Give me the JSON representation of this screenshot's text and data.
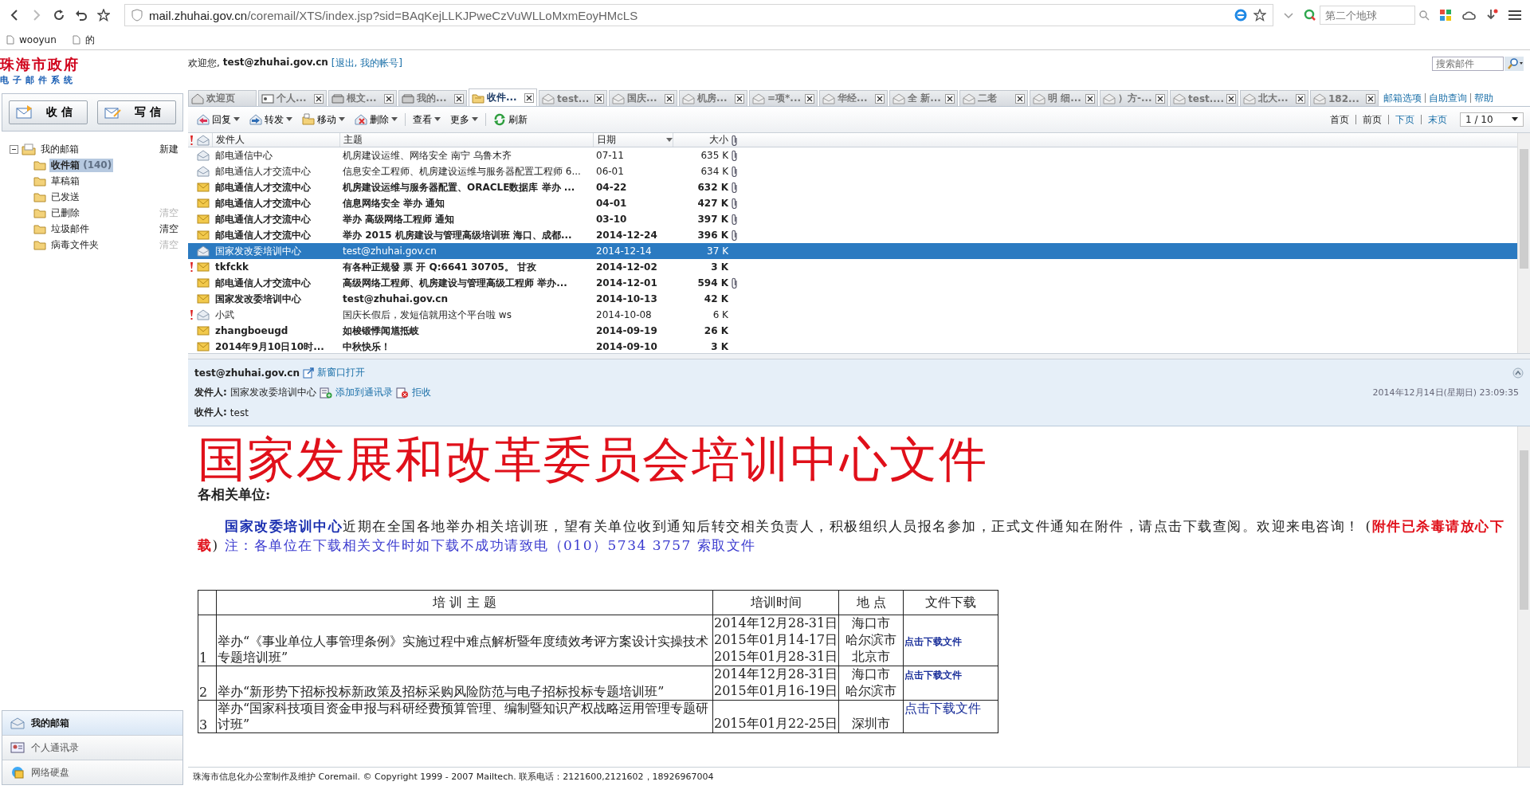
{
  "browser": {
    "url_host": "mail.zhuhai.gov.cn",
    "url_path": "/coremail/XTS/index.jsp?sid=BAqKejLLKJPweCzVuWLLoMxmEoyHMcLS",
    "search_placeholder": "第二个地球",
    "bookmarks": [
      "wooyun",
      "的"
    ]
  },
  "header": {
    "logo_title": "珠海市政府",
    "logo_subtitle": "电子邮件系统",
    "welcome": "欢迎您,",
    "user": "test@zhuhai.gov.cn",
    "account_links": "[退出, 我的帐号]",
    "search_placeholder": "搜索邮件"
  },
  "mail_buttons": [
    "收 信",
    "写 信"
  ],
  "folders": {
    "label": "我的邮箱",
    "action": "新建",
    "expanded": true,
    "children": [
      {
        "label": "收件箱",
        "count": "(140)",
        "selected": true
      },
      {
        "label": "草稿箱",
        "selected": false
      },
      {
        "label": "已发送",
        "selected": false
      },
      {
        "label": "已删除",
        "action": "清空",
        "disabled": true,
        "selected": false
      },
      {
        "label": "垃圾邮件",
        "action": "清空",
        "disabled": false,
        "selected": false
      },
      {
        "label": "病毒文件夹",
        "action": "清空",
        "disabled": true,
        "selected": false
      }
    ]
  },
  "nav": [
    {
      "label": "我的邮箱",
      "selected": true
    },
    {
      "label": "个人通讯录",
      "selected": false
    },
    {
      "label": "网络硬盘",
      "selected": false
    }
  ],
  "tabs": [
    {
      "label": "欢迎页",
      "kind": "home",
      "selected": false
    },
    {
      "label": "个人...",
      "kind": "contacts",
      "selected": false
    },
    {
      "label": "根文...",
      "kind": "folder",
      "selected": false
    },
    {
      "label": "我的...",
      "kind": "folder",
      "selected": false
    },
    {
      "label": "收件...",
      "kind": "inbox",
      "selected": true
    },
    {
      "label": "test...",
      "kind": "mail",
      "selected": false
    },
    {
      "label": "国庆...",
      "kind": "mail",
      "selected": false
    },
    {
      "label": "机房...",
      "kind": "mail",
      "selected": false
    },
    {
      "label": "=项*...",
      "kind": "mail",
      "selected": false
    },
    {
      "label": "华经...",
      "kind": "mail",
      "selected": false
    },
    {
      "label": "全 新...",
      "kind": "mail",
      "selected": false
    },
    {
      "label": "二老",
      "kind": "mail",
      "selected": false
    },
    {
      "label": "明 细...",
      "kind": "mail",
      "selected": false
    },
    {
      "label": "）方-...",
      "kind": "mail",
      "selected": false
    },
    {
      "label": "test....",
      "kind": "mail",
      "selected": false
    },
    {
      "label": "北大...",
      "kind": "mail",
      "selected": false
    },
    {
      "label": "182...",
      "kind": "mail",
      "selected": false
    }
  ],
  "top_links": [
    "邮箱选项",
    "自助查询",
    "帮助"
  ],
  "toolbar": [
    {
      "label": "回复",
      "dropdown": true
    },
    {
      "label": "转发",
      "dropdown": true
    },
    {
      "label": "移动",
      "dropdown": true
    },
    {
      "label": "删除",
      "dropdown": true
    },
    {
      "label": "查看",
      "dropdown": true
    },
    {
      "label": "更多",
      "dropdown": true
    },
    {
      "label": "刷新",
      "dropdown": false
    }
  ],
  "pager": {
    "links": [
      {
        "label": "首页",
        "disabled": true
      },
      {
        "label": "前页",
        "disabled": true
      },
      {
        "label": "下页",
        "disabled": false
      },
      {
        "label": "末页",
        "disabled": false
      }
    ],
    "page": "1 / 10"
  },
  "mail_list": {
    "columns": [
      "发件人",
      "主题",
      "日期",
      "大小"
    ],
    "rows": [
      {
        "sender": "邮电通信中心",
        "subject": "机房建设运维、网络安全 南宁 乌鲁木齐",
        "date": "07-11",
        "size": "635 K",
        "unread": false,
        "flagged": false,
        "attachment": true,
        "selected": false
      },
      {
        "sender": "邮电通信人才交流中心",
        "subject": "信息安全工程师、机房建设运维与服务器配置工程师 6...",
        "date": "06-01",
        "size": "634 K",
        "unread": false,
        "flagged": false,
        "attachment": true,
        "selected": false
      },
      {
        "sender": "邮电通信人才交流中心",
        "subject": "机房建设运维与服务器配置、ORACLE数据库 举办 ...",
        "date": "04-22",
        "size": "632 K",
        "unread": true,
        "flagged": false,
        "attachment": true,
        "selected": false
      },
      {
        "sender": "邮电通信人才交流中心",
        "subject": "信息网络安全 举办 通知",
        "date": "04-01",
        "size": "427 K",
        "unread": true,
        "flagged": false,
        "attachment": true,
        "selected": false
      },
      {
        "sender": "邮电通信人才交流中心",
        "subject": "举办 高级网络工程师 通知",
        "date": "03-10",
        "size": "397 K",
        "unread": true,
        "flagged": false,
        "attachment": true,
        "selected": false
      },
      {
        "sender": "邮电通信人才交流中心",
        "subject": "举办 2015 机房建设与管理高级培训班 海口、成都...",
        "date": "2014-12-24",
        "size": "396 K",
        "unread": true,
        "flagged": false,
        "attachment": true,
        "selected": false
      },
      {
        "sender": "国家发改委培训中心",
        "subject": "test@zhuhai.gov.cn",
        "date": "2014-12-14",
        "size": "37 K",
        "unread": false,
        "flagged": false,
        "attachment": false,
        "selected": true
      },
      {
        "sender": "tkfckk",
        "subject": "有各种正规發 票 开 Q:6641 30705。 甘孜",
        "date": "2014-12-02",
        "size": "3 K",
        "unread": true,
        "flagged": true,
        "attachment": false,
        "selected": false
      },
      {
        "sender": "邮电通信人才交流中心",
        "subject": "高级网络工程师、机房建设与管理高级工程师 举办...",
        "date": "2014-12-01",
        "size": "594 K",
        "unread": true,
        "flagged": false,
        "attachment": true,
        "selected": false
      },
      {
        "sender": "国家发改委培训中心",
        "subject": "test@zhuhai.gov.cn",
        "date": "2014-10-13",
        "size": "42 K",
        "unread": true,
        "flagged": false,
        "attachment": false,
        "selected": false
      },
      {
        "sender": "小武",
        "subject": "国庆长假后，发短信就用这个平台啦 ws",
        "date": "2014-10-08",
        "size": "6 K",
        "unread": false,
        "flagged": true,
        "attachment": false,
        "selected": false
      },
      {
        "sender": "zhangboeugd",
        "subject": "如梭锻悸闻馗抵岐",
        "date": "2014-09-19",
        "size": "26 K",
        "unread": true,
        "flagged": false,
        "attachment": false,
        "selected": false
      },
      {
        "sender": "2014年9月10日10时...",
        "subject": "中秋快乐！",
        "date": "2014-09-10",
        "size": "3 K",
        "unread": true,
        "flagged": false,
        "attachment": false,
        "selected": false
      }
    ]
  },
  "preview": {
    "address": "test@zhuhai.gov.cn",
    "open_link": "新窗口打开",
    "from_label": "发件人:",
    "from": "国家发改委培训中心",
    "from_actions": [
      "添加到通讯录",
      "拒收"
    ],
    "date": "2014年12月14日(星期日) 23:09:35",
    "to_label": "收件人:",
    "to": "test"
  },
  "message": {
    "title": "国家发展和改革委员会培训中心文件",
    "greeting": "各相关单位:",
    "paragraph": [
      {
        "kind": "org",
        "text": "国家改委培训中心"
      },
      {
        "kind": "plain",
        "text": "近期在全国各地举办相关培训班，望有关单位收到通知后转交相关负责人，积极组织人员报名参加，正式文件通知在附件，请点击下载查阅。欢迎来电咨询！ ("
      },
      {
        "kind": "warning",
        "text": "附件已杀毒请放心下载"
      },
      {
        "kind": "plain",
        "text": ")  "
      },
      {
        "kind": "note",
        "text": "注：各单位在下载相关文件时如下载不成功请致电（010）5734 3757 索取文件"
      }
    ],
    "table": {
      "columns": [
        "培 训 主 题",
        "培训时间",
        "地 点",
        "文件下载"
      ],
      "rows": [
        {
          "number": "1",
          "topic": "举办“《事业单位人事管理条例》实施过程中难点解析暨年度绩效考评方案设计实操技术专题培训班”",
          "dates": [
            "2014年12月28-31日",
            "2015年01月14-17日",
            "2015年01月28-31日"
          ],
          "places": [
            "海口市",
            "哈尔滨市",
            "北京市"
          ],
          "download": "点击下载文件",
          "large": false
        },
        {
          "number": "2",
          "topic": "举办“新形势下招标投标新政策及招标采购风险防范与电子招标投标专题培训班”",
          "dates": [
            "2014年12月28-31日",
            "2015年01月16-19日"
          ],
          "places": [
            "海口市",
            "哈尔滨市"
          ],
          "download": "点击下载文件",
          "large": false
        },
        {
          "number": "3",
          "topic": "举办“国家科技项目资金申报与科研经费预算管理、编制暨知识产权战略运用管理专题研讨班”",
          "dates": [
            "2015年01月22-25日"
          ],
          "places": [
            "深圳市"
          ],
          "download": "点击下载文件",
          "large": true
        }
      ]
    }
  },
  "footer": "珠海市信息化办公室制作及维护 Coremail. © Copyright 1999 - 2007 Mailtech. 联系电话：2121600,2121602，18926967004"
}
